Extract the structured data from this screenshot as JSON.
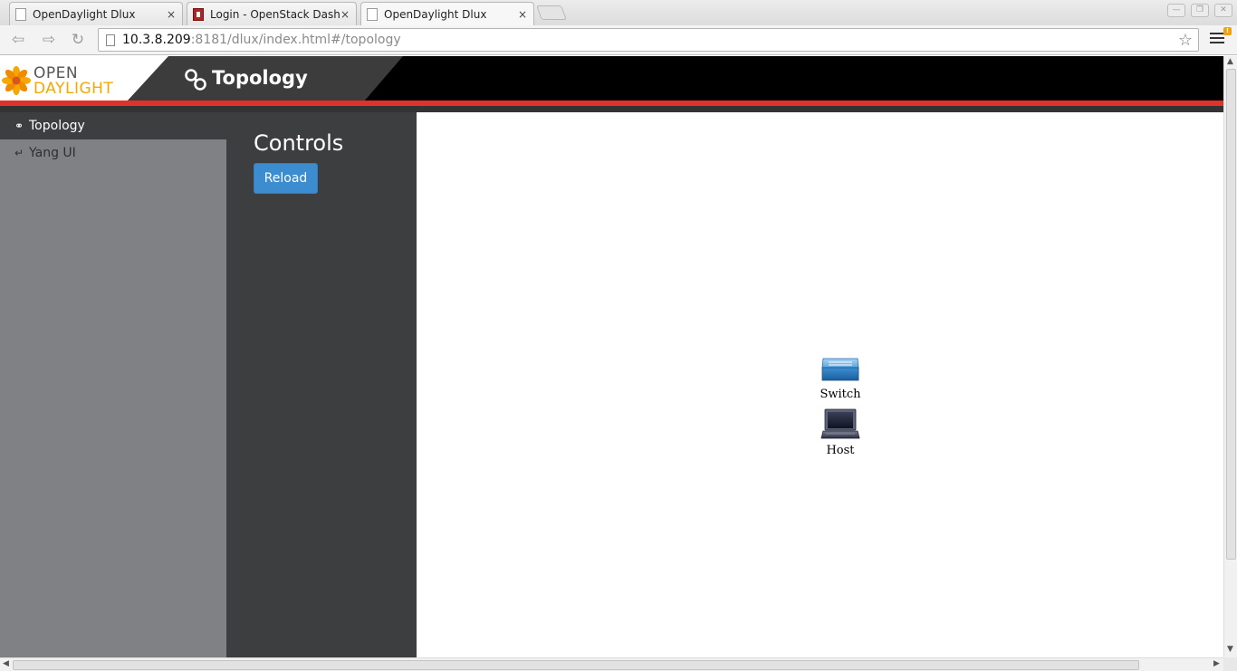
{
  "browser": {
    "tabs": [
      {
        "title": "OpenDaylight Dlux",
        "icon": "page-icon",
        "active": false
      },
      {
        "title": "Login - OpenStack Dashbc",
        "icon": "openstack-icon",
        "active": false
      },
      {
        "title": "OpenDaylight Dlux",
        "icon": "page-icon",
        "active": true
      }
    ],
    "tab_close_glyph": "×",
    "url_host": "10.3.8.209",
    "url_rest": ":8181/dlux/index.html#/topology"
  },
  "header": {
    "logo_top": "OPEN",
    "logo_bottom": "DAYLIGHT",
    "title": "Topology",
    "colors": {
      "accent_red": "#e0312b",
      "logo_orange": "#f5a800"
    }
  },
  "sidebar": {
    "items": [
      {
        "label": "Topology",
        "icon": "link-icon",
        "active": true
      },
      {
        "label": "Yang UI",
        "icon": "arrow-icon",
        "active": false
      }
    ]
  },
  "controls": {
    "title": "Controls",
    "reload_label": "Reload",
    "button_color": "#3c8dcf"
  },
  "topology": {
    "nodes": [
      {
        "label": "Switch",
        "icon": "switch-icon"
      },
      {
        "label": "Host",
        "icon": "host-icon"
      }
    ]
  }
}
